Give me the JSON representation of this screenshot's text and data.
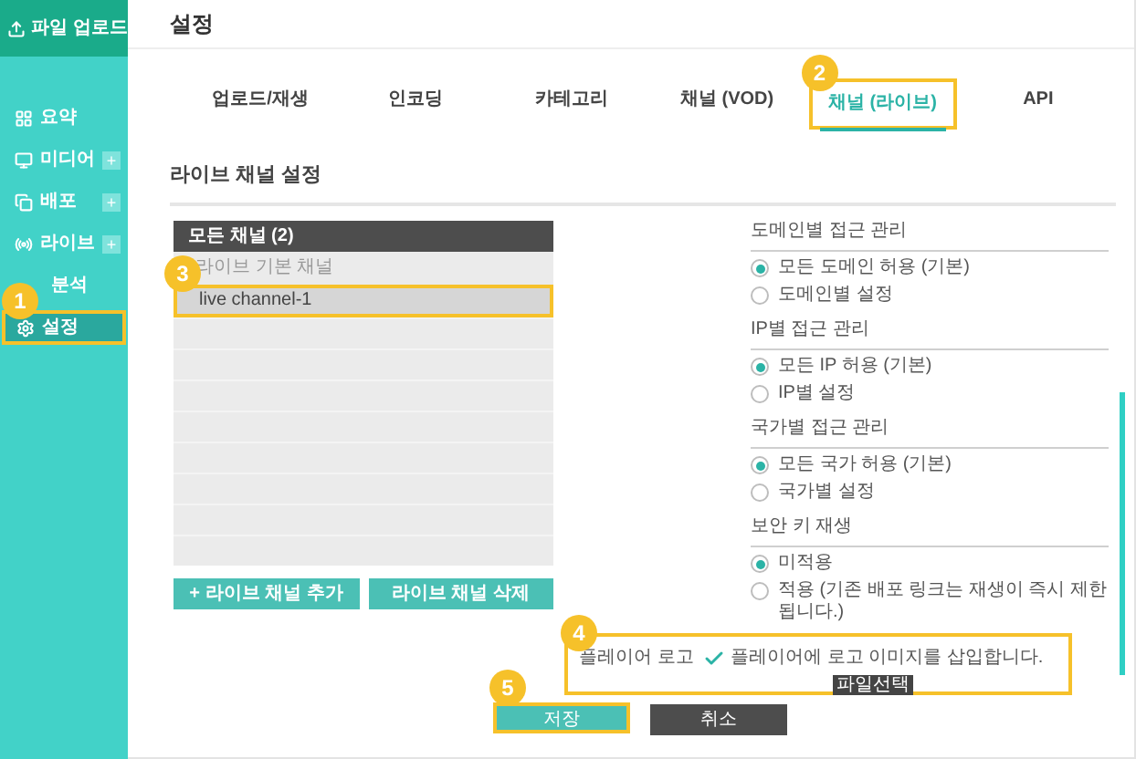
{
  "sidebar": {
    "upload_button": "파일 업로드",
    "items": [
      {
        "label": "요약",
        "selected": false
      },
      {
        "label": "미디어",
        "plus": "+",
        "selected": false
      },
      {
        "label": "배포",
        "plus": "+",
        "selected": false
      },
      {
        "label": "라이브",
        "plus": "+",
        "selected": false
      },
      {
        "label": "분석",
        "selected": false
      },
      {
        "label": "설정",
        "selected": true,
        "callout": "1"
      }
    ]
  },
  "page_title": "설정",
  "tabs": [
    {
      "label": "업로드/재생",
      "selected": false
    },
    {
      "label": "인코딩",
      "selected": false
    },
    {
      "label": "카테고리",
      "selected": false
    },
    {
      "label": "채널 (VOD)",
      "selected": false
    },
    {
      "label": "채널 (라이브)",
      "selected": true,
      "callout": "2"
    },
    {
      "label": "API",
      "selected": false
    }
  ],
  "section_title": "라이브 채널 설정",
  "channel_list": {
    "header": "모든 채널 (2)",
    "rows": [
      {
        "label": "라이브 기본 채널",
        "selected": false
      },
      {
        "label": "live channel-1",
        "selected": true,
        "callout": "3"
      }
    ],
    "buttons": [
      "+ 라이브 채널 추가",
      "라이브 채널 삭제"
    ]
  },
  "settings": [
    {
      "title": "도메인별 접근 관리",
      "options": [
        {
          "label": "모든 도메인 허용 (기본)",
          "selected": true
        },
        {
          "label": "도메인별 설정",
          "selected": false
        }
      ]
    },
    {
      "title": "IP별 접근 관리",
      "options": [
        {
          "label": "모든 IP 허용 (기본)",
          "selected": true
        },
        {
          "label": "IP별 설정",
          "selected": false
        }
      ]
    },
    {
      "title": "국가별 접근 관리",
      "options": [
        {
          "label": "모든 국가 허용 (기본)",
          "selected": true
        },
        {
          "label": "국가별 설정",
          "selected": false
        }
      ]
    },
    {
      "title": "보안 키 재생",
      "options": [
        {
          "label": "미적용",
          "selected": true
        },
        {
          "label": "적용 (기존 배포 링크는 재생이 즉시 제한됩니다.)",
          "selected": false
        }
      ]
    }
  ],
  "player_logo": {
    "label": "플레이어 로고",
    "checked": true,
    "description": "플레이어에 로고 이미지를 삽입합니다.",
    "file_button": "파일선택",
    "callout": "4"
  },
  "actions": [
    {
      "label": "저장",
      "kind": "primary",
      "callout": "5"
    },
    {
      "label": "취소",
      "kind": "secondary"
    }
  ]
}
